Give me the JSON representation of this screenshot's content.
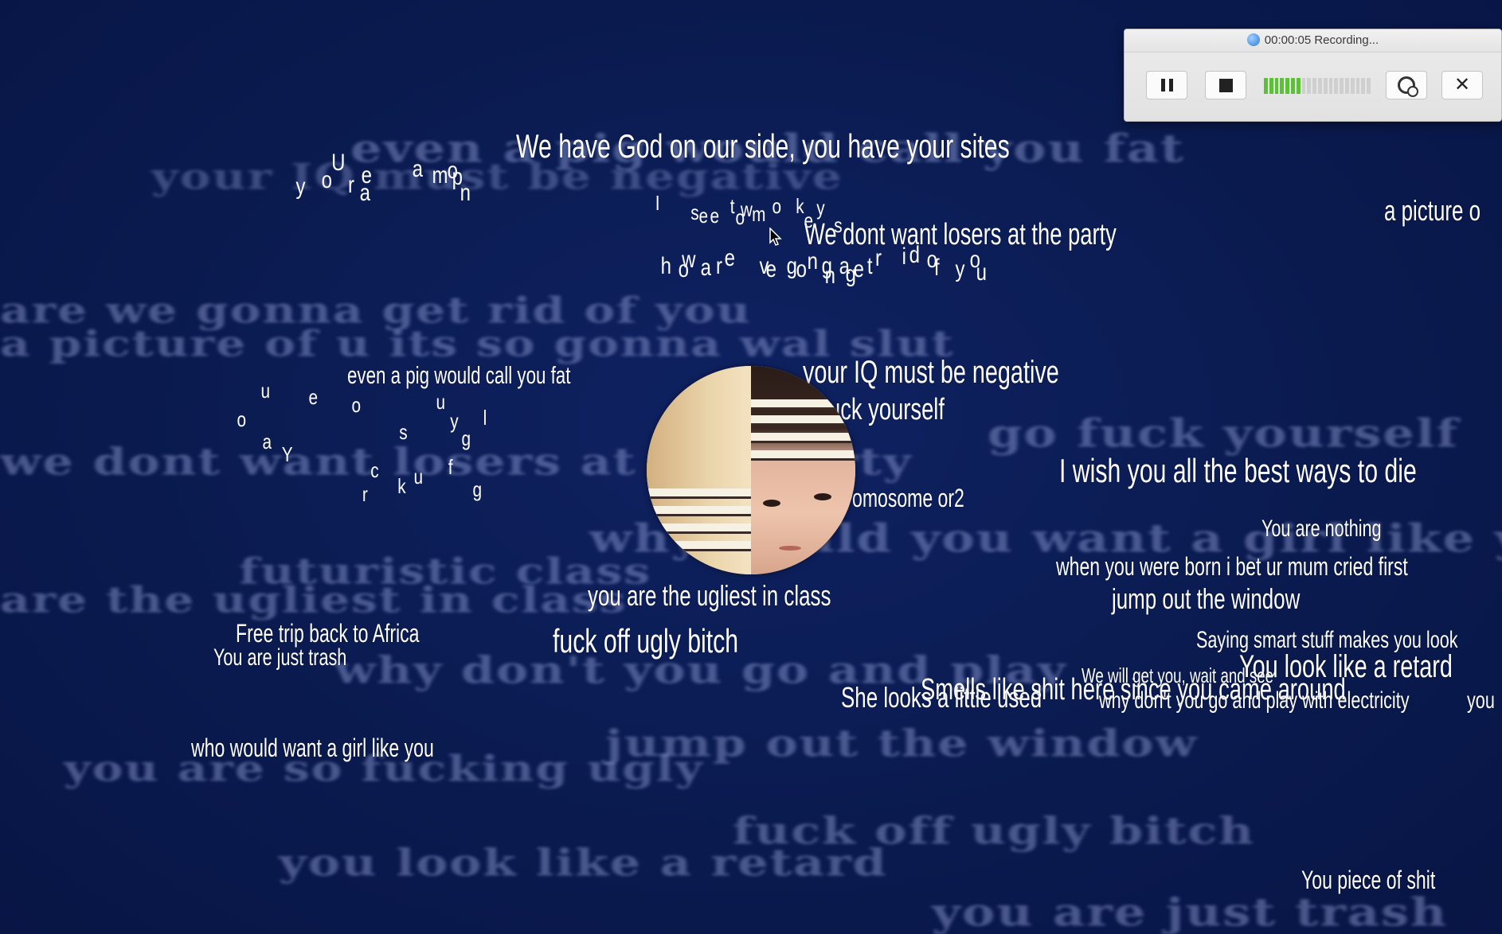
{
  "recorder": {
    "title": "00:00:05 Recording...",
    "level_fraction": 0.35,
    "buttons": [
      "pause-icon",
      "stop-icon",
      "webcam-icon",
      "close-icon"
    ]
  },
  "phrases": {
    "god_on_our_side": "We have God on our side, you have your sites",
    "losers_party": "We dont want losers at the party",
    "picture": "a picture o",
    "pig_fat": "even a pig would call you fat",
    "iq_negative": "your IQ must be negative",
    "fuck_yourself": "uck yourself",
    "best_ways_die": "I wish you all the best ways to die",
    "chromosome": "omosome or2",
    "you_are_nothing": "You are nothing",
    "mum_cried": "when you were born i bet ur mum cried first",
    "jump_window": "jump out the window",
    "ugliest_class": "you are the ugliest in class",
    "fuck_off": "fuck off ugly bitch",
    "trip_africa": "Free trip back to Africa",
    "just_trash": "You are just trash",
    "smart_stuff": "Saying smart stuff makes you look",
    "look_retard": "You look like a retard",
    "get_you": "We will get you, wait and see",
    "looks_used": "She looks a little used",
    "smells_shit": "Smells like shit here since you came around",
    "electricity": "why don't you go and play with electricity",
    "you_tail": "you",
    "girl_like_you": "who would want a girl like you",
    "piece_of_shit": "You piece of shit"
  },
  "ghosts": {
    "g1": "even a pig would call you fat",
    "g2": "your IQ must be negative",
    "g3": "are we gonna get rid of you",
    "g4": "a picture of u its so gonna wal slut",
    "g5": "go fuck yourself",
    "g6": "we dont want losers at the party",
    "g7": "why would you want a girl like you",
    "g8": "futuristic class",
    "g9": "are the ugliest in class",
    "g10": "why don't you go and play",
    "g11": "jump out the window",
    "g12": "you are so fucking ugly",
    "g13": "fuck off ugly bitch",
    "g14": "you look like a retard",
    "g15": "you are just trash"
  },
  "letters": {
    "cluster1": [
      "y",
      "o",
      "U",
      "r",
      "a",
      "e",
      "a",
      "m",
      "o",
      "n",
      "p"
    ],
    "cluster2": [
      "I",
      "s",
      "e",
      "e",
      "t",
      "w",
      "o",
      "o",
      "m",
      "k",
      "e",
      "y",
      "s"
    ],
    "cluster3": [
      "h",
      "o",
      "a",
      "w",
      "r",
      "e",
      "v",
      "e",
      "g",
      "o",
      "n",
      "g",
      "n",
      "a",
      "g",
      "e",
      "t",
      "r",
      "i",
      "d",
      "o",
      "f",
      "y",
      "o",
      "u"
    ],
    "cluster4": [
      "u",
      "e",
      "o",
      "u",
      "o",
      "y",
      "l",
      "s",
      "a",
      "Y",
      "g",
      "c",
      "u",
      "k",
      "f",
      "r",
      "g"
    ]
  }
}
